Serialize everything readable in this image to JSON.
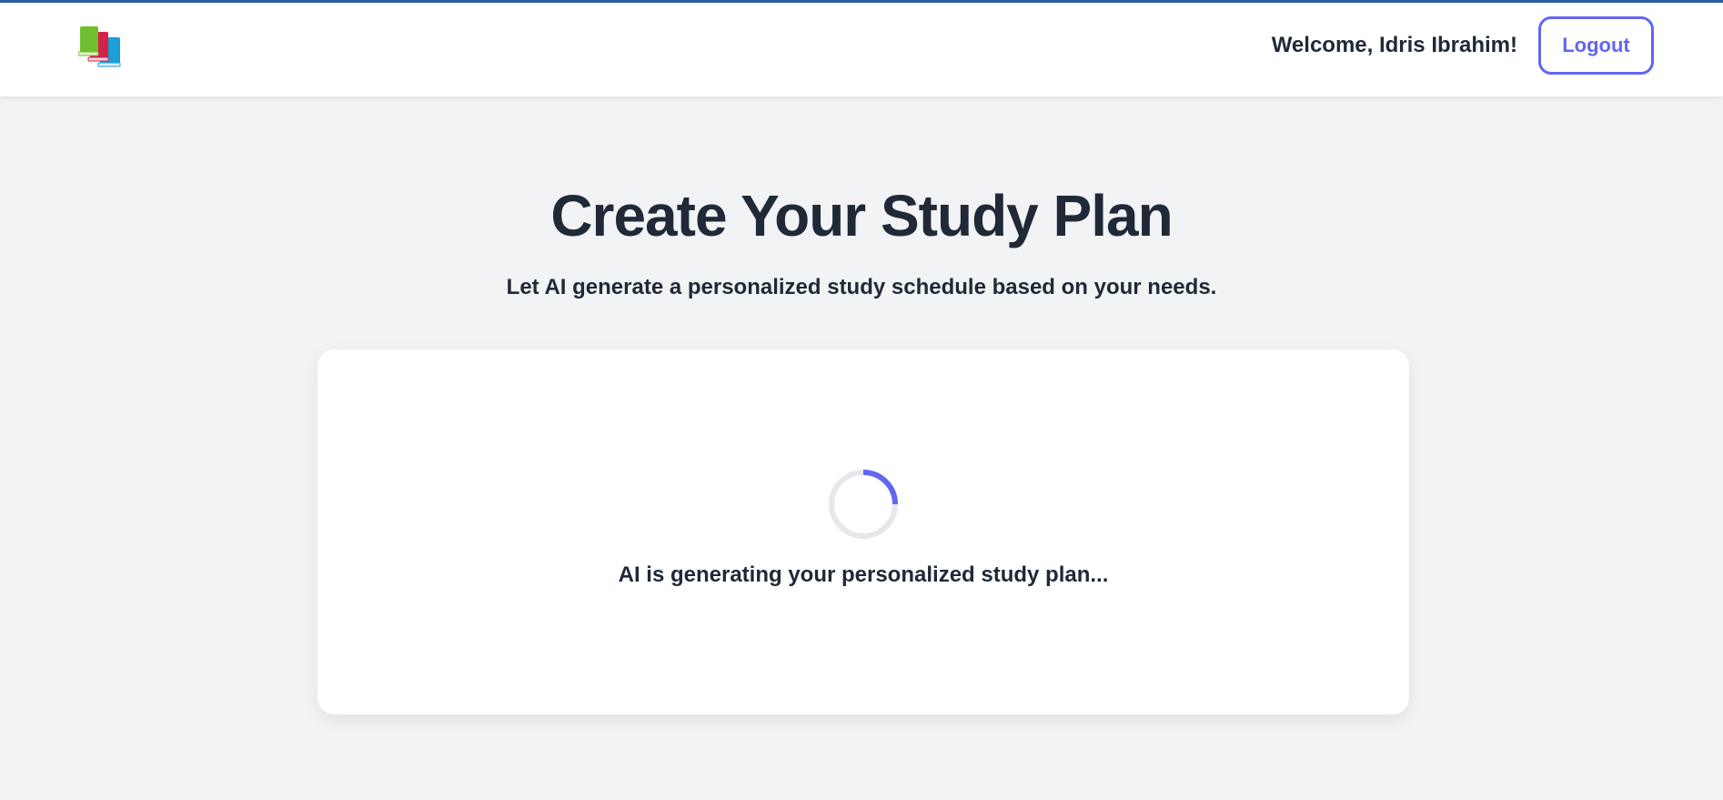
{
  "header": {
    "logo_icon": "books-stack-icon",
    "welcome_text": "Welcome, Idris Ibrahim!",
    "logout_label": "Logout"
  },
  "main": {
    "title": "Create Your Study Plan",
    "subtitle": "Let AI generate a personalized study schedule based on your needs.",
    "loading": {
      "spinner_icon": "loading-spinner-icon",
      "text": "AI is generating your personalized study plan..."
    }
  },
  "colors": {
    "accent": "#6366f1",
    "top_border": "#2b5ea7",
    "background": "#f2f3f5",
    "text": "#1f2937"
  }
}
